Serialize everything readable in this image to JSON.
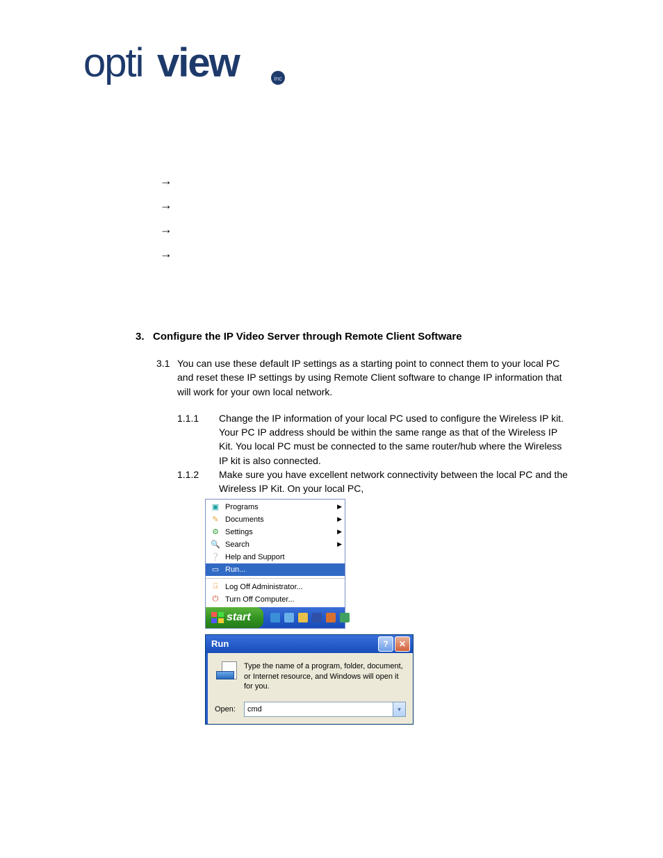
{
  "logo": {
    "text1": "opti",
    "text2": "view",
    "badge": "inc"
  },
  "section": {
    "number": "3.",
    "title": "Configure the IP Video Server through Remote Client Software"
  },
  "para31": {
    "num": "3.1",
    "text": "You can use these default IP settings as a starting point to connect them to your local PC and reset these IP settings by using Remote Client software to change IP information that will work for your own local network."
  },
  "sub111": {
    "num": "1.1.1",
    "text": "Change the IP information of your local PC used to configure the Wireless IP kit. Your PC IP address should be within the same range as that of the Wireless IP Kit. You local PC must be connected to the same router/hub where the Wireless IP kit is also connected."
  },
  "sub112": {
    "num": "1.1.2",
    "text": "Make sure you have excellent network connectivity between the local PC and the Wireless IP Kit. On your local PC,"
  },
  "startmenu": {
    "programs": "Programs",
    "documents": "Documents",
    "settings": "Settings",
    "search": "Search",
    "help": "Help and Support",
    "run": "Run...",
    "logoff": "Log Off Administrator...",
    "turnoff": "Turn Off Computer...",
    "start": "start"
  },
  "rundlg": {
    "title": "Run",
    "desc": "Type the name of a program, folder, document, or Internet resource, and Windows will open it for you.",
    "openlabel": "Open:",
    "value": "cmd"
  }
}
